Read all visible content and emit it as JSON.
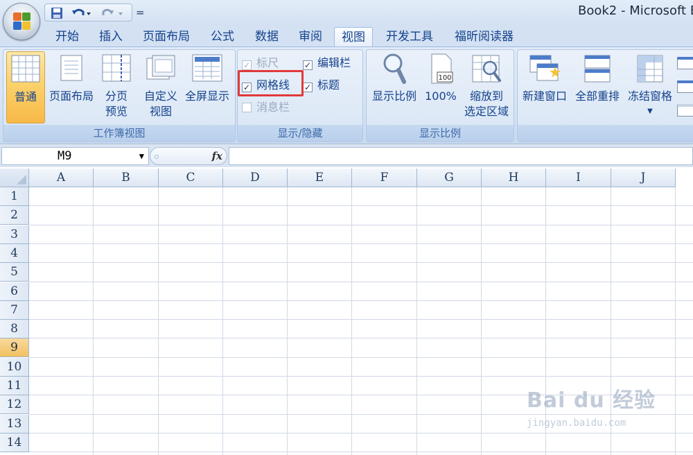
{
  "title_bar": {
    "app_title": "Book2 - Microsoft E",
    "qat": {
      "save_icon": "save-icon",
      "undo_icon": "undo-icon",
      "redo_icon": "redo-icon",
      "more_label": "="
    }
  },
  "tabs": [
    {
      "label": "开始"
    },
    {
      "label": "插入"
    },
    {
      "label": "页面布局"
    },
    {
      "label": "公式"
    },
    {
      "label": "数据"
    },
    {
      "label": "审阅"
    },
    {
      "label": "视图",
      "active": true
    },
    {
      "label": "开发工具"
    },
    {
      "label": "福昕阅读器"
    }
  ],
  "ribbon": {
    "workbook_views": {
      "label": "工作簿视图",
      "normal": "普通",
      "page_layout": "页面布局",
      "page_break_1": "分页",
      "page_break_2": "预览",
      "custom_1": "自定义",
      "custom_2": "视图",
      "full_screen": "全屏显示"
    },
    "show_hide": {
      "label": "显示/隐藏",
      "ruler": "标尺",
      "formula_bar": "编辑栏",
      "gridlines": "网格线",
      "headings": "标题",
      "message_bar": "消息栏",
      "ruler_checked": true,
      "formula_bar_checked": true,
      "gridlines_checked": true,
      "headings_checked": true,
      "message_bar_checked": false
    },
    "zoom": {
      "label": "显示比例",
      "zoom": "显示比例",
      "hundred": "100%",
      "zoom_sel_1": "缩放到",
      "zoom_sel_2": "选定区域"
    },
    "window": {
      "new_window": "新建窗口",
      "arrange_all": "全部重排",
      "freeze_panes": "冻结窗格"
    }
  },
  "formula_bar": {
    "name_box": "M9",
    "fx": "fx",
    "formula": ""
  },
  "grid": {
    "columns": [
      "A",
      "B",
      "C",
      "D",
      "E",
      "F",
      "G",
      "H",
      "I",
      "J"
    ],
    "rows": [
      "1",
      "2",
      "3",
      "4",
      "5",
      "6",
      "7",
      "8",
      "9",
      "10",
      "11",
      "12",
      "13",
      "14"
    ],
    "active_row": "9"
  },
  "watermark": {
    "text": "Bai du 经验",
    "url": "jingyan.baidu.com"
  },
  "colors": {
    "accent": "#15428b",
    "highlight_box": "#e03a3a",
    "selected_button": "#fbd26c"
  }
}
